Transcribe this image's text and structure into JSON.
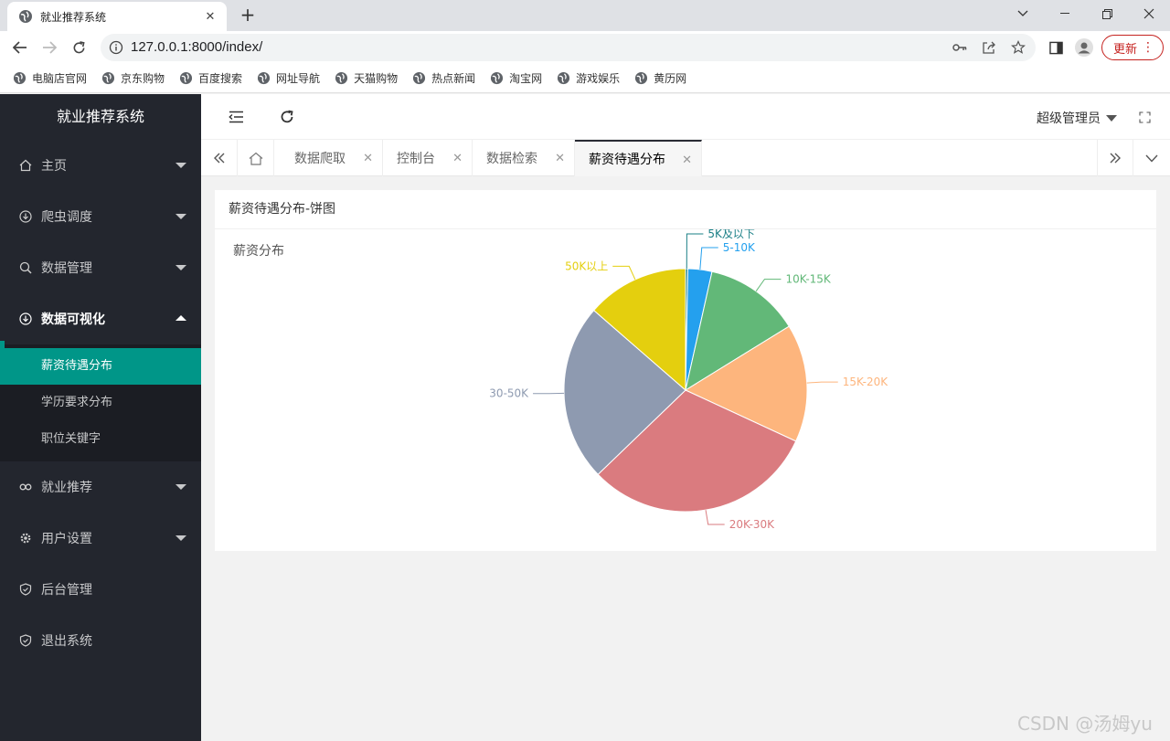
{
  "browser": {
    "tab_title": "就业推荐系统",
    "url": "127.0.0.1:8000/index/",
    "update_label": "更新"
  },
  "bookmarks": [
    "电脑店官网",
    "京东购物",
    "百度搜索",
    "网址导航",
    "天猫购物",
    "热点新闻",
    "淘宝网",
    "游戏娱乐",
    "黄历网"
  ],
  "sidebar": {
    "logo": "就业推荐系统",
    "items": [
      {
        "label": "主页",
        "icon": "home-icon"
      },
      {
        "label": "爬虫调度",
        "icon": "download-icon"
      },
      {
        "label": "数据管理",
        "icon": "search-icon"
      },
      {
        "label": "数据可视化",
        "icon": "download-icon"
      },
      {
        "label": "就业推荐",
        "icon": "link-icon"
      },
      {
        "label": "用户设置",
        "icon": "gear-icon"
      },
      {
        "label": "后台管理",
        "icon": "shield-icon"
      },
      {
        "label": "退出系统",
        "icon": "shield-icon"
      }
    ],
    "submenu": [
      "薪资待遇分布",
      "学历要求分布",
      "职位关键字"
    ]
  },
  "header": {
    "user": "超级管理员"
  },
  "tabs": [
    "数据爬取",
    "控制台",
    "数据检索",
    "薪资待遇分布"
  ],
  "card": {
    "title": "薪资待遇分布-饼图"
  },
  "chart_data": {
    "type": "pie",
    "title": "薪资分布",
    "slices": [
      {
        "label": "5K及以下",
        "value": 0.3,
        "color": "#1a7f86"
      },
      {
        "label": "5-10K",
        "value": 3.2,
        "color": "#24a0ee"
      },
      {
        "label": "10K-15K",
        "value": 12.7,
        "color": "#62b878"
      },
      {
        "label": "15K-20K",
        "value": 15.7,
        "color": "#fdb57d"
      },
      {
        "label": "20K-30K",
        "value": 30.9,
        "color": "#da7b7f"
      },
      {
        "label": "30-50K",
        "value": 23.6,
        "color": "#8e9ab0"
      },
      {
        "label": "50K以上",
        "value": 13.6,
        "color": "#e4cf0e"
      }
    ]
  },
  "watermark": "CSDN @汤姆yu"
}
